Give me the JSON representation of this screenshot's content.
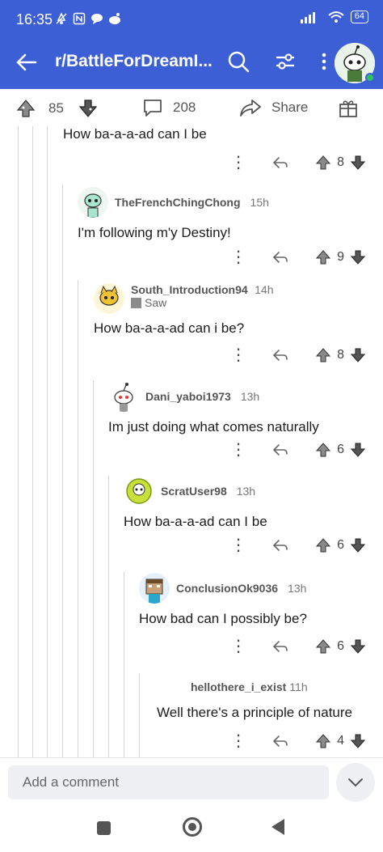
{
  "status_bar": {
    "time": "16:35",
    "battery": "64"
  },
  "app_bar": {
    "title": "r/BattleForDreamI...",
    "accent_color": "#3d5fd6"
  },
  "post_bar": {
    "upvotes": "85",
    "comments": "208",
    "share_label": "Share"
  },
  "comments": [
    {
      "body": "How ba-a-a-ad can I be",
      "score": "8"
    },
    {
      "username": "TheFrenchChingChong",
      "time": "15h",
      "body": "I'm following m'y Destiny!",
      "score": "9"
    },
    {
      "username": "South_Introduction94",
      "time": "14h",
      "flair": "Saw",
      "body": "How ba-a-a-ad can i be?",
      "score": "8"
    },
    {
      "username": "Dani_yaboi1973",
      "time": "13h",
      "body": "Im just doing what comes naturally",
      "score": "6"
    },
    {
      "username": "ScratUser98",
      "time": "13h",
      "body": "How ba-a-a-ad can I be",
      "score": "6"
    },
    {
      "username": "ConclusionOk9036",
      "time": "13h",
      "body": "How bad can I possibly be?",
      "score": "6"
    },
    {
      "username": "hellothere_i_exist",
      "time": "11h",
      "body": "Well there's a principle of nature",
      "score": "4"
    }
  ],
  "composer": {
    "placeholder": "Add a comment"
  }
}
